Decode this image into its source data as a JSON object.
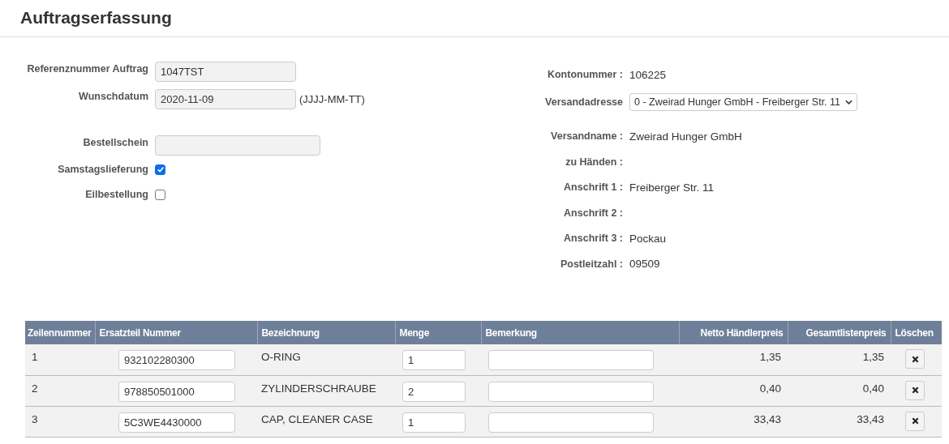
{
  "page": {
    "title": "Auftragserfassung"
  },
  "order_form": {
    "reference": {
      "label": "Referenznummer Auftrag",
      "value": "1047TST"
    },
    "desired_date": {
      "label": "Wunschdatum",
      "value": "2020-11-09",
      "hint": "(JJJJ-MM-TT)"
    },
    "order_slip": {
      "label": "Bestellschein"
    },
    "options": [
      {
        "label": "Samstagslieferung",
        "checked": true
      },
      {
        "label": "Eilbestellung",
        "checked": false
      }
    ]
  },
  "shipping": {
    "account": {
      "label": "Kontonummer :",
      "value": "106225"
    },
    "address_select": {
      "label": "Versandadresse",
      "value": "0 - Zweirad Hunger GmbH - Freiberger Str. 11"
    },
    "details": [
      {
        "label": "Versandname :",
        "value": "Zweirad Hunger GmbH"
      },
      {
        "label": "zu Händen :"
      },
      {
        "label": "Anschrift 1 :",
        "value": "Freiberger Str. 11"
      },
      {
        "label": "Anschrift 2 :"
      },
      {
        "label": "Anschrift 3 :",
        "value": "Pockau"
      },
      {
        "label": "Postleitzahl :",
        "value": "09509"
      }
    ]
  },
  "table": {
    "columns": [
      "Zeilennummer",
      "Ersatzteil Nummer",
      "Bezeichnung",
      "Menge",
      "Bemerkung",
      "Netto Händlerpreis",
      "Gesamtlistenpreis",
      "Löschen"
    ],
    "rows": [
      {
        "line": "1",
        "part_number": "932102280300",
        "description": "O-RING",
        "quantity": "1",
        "net_price": "1,35",
        "list_total": "1,35"
      },
      {
        "line": "2",
        "part_number": "978850501000",
        "description": "ZYLINDERSCHRAUBE",
        "quantity": "2",
        "net_price": "0,40",
        "list_total": "0,40"
      },
      {
        "line": "3",
        "part_number": "5C3WE4430000",
        "description": "CAP, CLEANER CASE",
        "quantity": "1",
        "net_price": "33,43",
        "list_total": "33,43"
      }
    ]
  }
}
